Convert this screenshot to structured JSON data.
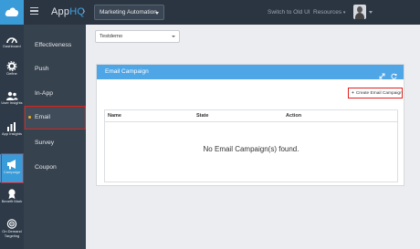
{
  "header": {
    "brand_prefix": "App",
    "brand_suffix": "HQ",
    "project": "Marketing Automation",
    "switch_old_ui": "Switch to Old UI",
    "resources": "Resources"
  },
  "rail": {
    "items": [
      {
        "label": "Dashboard",
        "icon": "speedometer-icon"
      },
      {
        "label": "Define",
        "icon": "gear-icon"
      },
      {
        "label": "User Insights",
        "icon": "users-icon"
      },
      {
        "label": "App Insights",
        "icon": "chart-icon"
      },
      {
        "label": "Campaign",
        "icon": "megaphone-icon",
        "active": true
      },
      {
        "label": "Benefit Mark",
        "icon": "badge-icon"
      },
      {
        "label": "On Demand Targeting",
        "icon": "target-icon"
      }
    ]
  },
  "subnav": {
    "items": [
      {
        "label": "Effectiveness"
      },
      {
        "label": "Push"
      },
      {
        "label": "In-App"
      },
      {
        "label": "Email",
        "active": true
      },
      {
        "label": "Survey"
      },
      {
        "label": "Coupon"
      }
    ]
  },
  "app_select": {
    "value": "Testdemo"
  },
  "panel": {
    "title": "Email Campaign",
    "create_button": "Create Email Campaign",
    "create_icon": "+",
    "columns": [
      "Name",
      "State",
      "Action"
    ],
    "empty_message": "No Email Campaign(s) found."
  },
  "colors": {
    "topbar": "#2b3542",
    "accent": "#3a9bd9",
    "panel_header": "#4fa6e6",
    "highlight": "#e0201c"
  }
}
